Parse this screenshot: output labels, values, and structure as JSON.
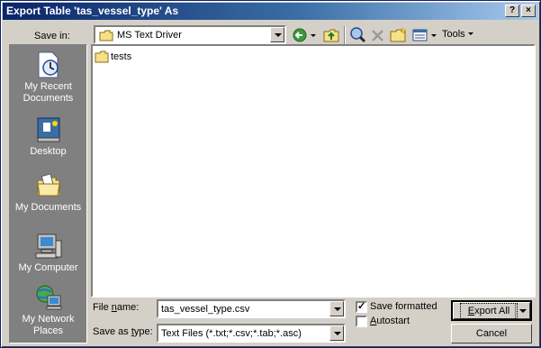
{
  "window": {
    "title": "Export Table 'tas_vessel_type' As",
    "help_button": "?",
    "close_button": "×"
  },
  "save_in": {
    "label": "Save in:",
    "value": "MS Text Driver"
  },
  "toolbar": {
    "tools_label": "Tools"
  },
  "places": [
    {
      "label": "My Recent Documents",
      "icon": "clock-document-icon"
    },
    {
      "label": "Desktop",
      "icon": "desktop-icon"
    },
    {
      "label": "My Documents",
      "icon": "folder-documents-icon"
    },
    {
      "label": "My Computer",
      "icon": "computer-icon"
    },
    {
      "label": "My Network Places",
      "icon": "network-globe-icon"
    }
  ],
  "files": [
    {
      "name": "tests",
      "type": "folder"
    }
  ],
  "file_name": {
    "label": "File name:",
    "value": "tas_vessel_type.csv"
  },
  "save_as_type": {
    "label": "Save as type:",
    "value": "Text Files (*.txt;*.csv;*.tab;*.asc)"
  },
  "options": {
    "save_formatted_label": "Save formatted",
    "save_formatted_checked": true,
    "autostart_label": "Autostart",
    "autostart_checked": false
  },
  "buttons": {
    "export_label": "Export All",
    "cancel_label": "Cancel"
  }
}
